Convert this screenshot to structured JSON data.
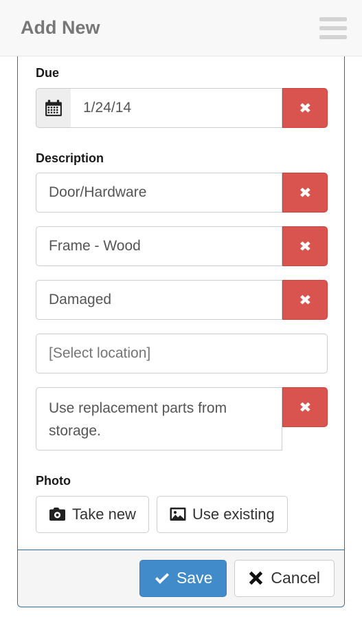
{
  "header": {
    "title": "Add New",
    "menu_icon": "hamburger-menu-icon"
  },
  "form": {
    "due": {
      "label": "Due",
      "calendar_icon": "calendar-icon",
      "value": "1/24/14",
      "placeholder": "",
      "delete_label": "✖"
    },
    "description": {
      "label": "Description",
      "items": [
        {
          "value": "Door/Hardware",
          "placeholder": "",
          "type": "input",
          "delete_label": "✖",
          "has_delete": true
        },
        {
          "value": "Frame - Wood",
          "placeholder": "",
          "type": "input",
          "delete_label": "✖",
          "has_delete": true
        },
        {
          "value": "Damaged",
          "placeholder": "",
          "type": "input",
          "delete_label": "✖",
          "has_delete": true
        },
        {
          "value": "",
          "placeholder": "[Select location]",
          "type": "input",
          "delete_label": "",
          "has_delete": false
        },
        {
          "value": "Use replacement parts from storage.",
          "placeholder": "",
          "type": "textarea",
          "delete_label": "✖",
          "has_delete": true
        }
      ]
    },
    "photo": {
      "label": "Photo",
      "take_new_label": "Take new",
      "take_new_icon": "camera-icon",
      "use_existing_label": "Use existing",
      "use_existing_icon": "picture-image-icon"
    }
  },
  "footer": {
    "save_label": "Save",
    "save_icon": "check-icon",
    "cancel_label": "Cancel",
    "cancel_icon": "x-mark-icon"
  },
  "colors": {
    "danger": "#d9534f",
    "primary": "#428bca",
    "panel_border": "#2e6da4",
    "header_bg": "#f8f8f8",
    "header_text": "#777777",
    "footer_bg": "#f5f5f5"
  }
}
